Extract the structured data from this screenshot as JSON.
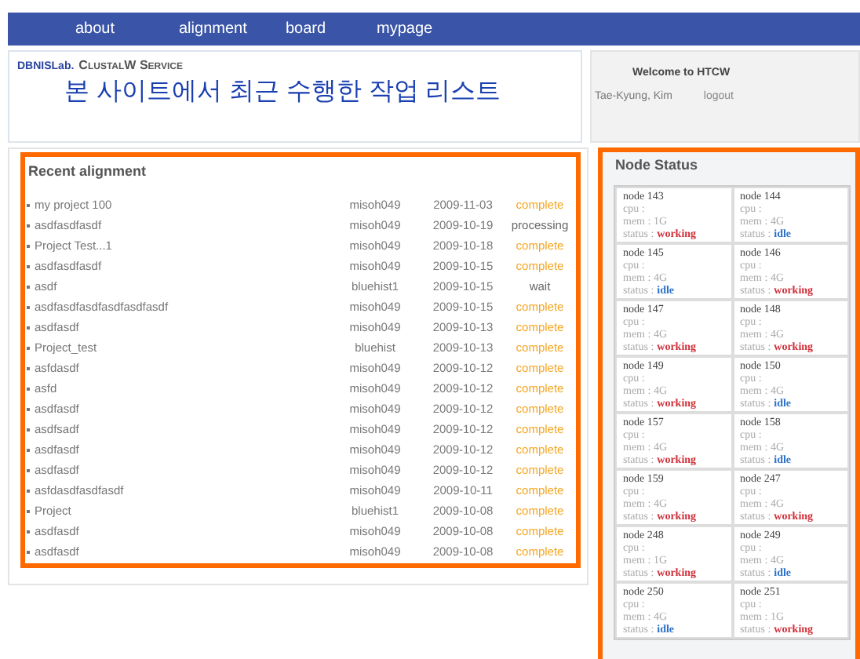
{
  "nav": [
    "about",
    "alignment",
    "board",
    "mypage"
  ],
  "header": {
    "brand": "DBNISLab.",
    "service": "ClustalW Service",
    "title": "본 사이트에서 최근 수행한 작업 리스트"
  },
  "welcome": {
    "title": "Welcome to HTCW",
    "user": "Tae-Kyung, Kim",
    "logout": "logout"
  },
  "recent": {
    "title": "Recent alignment",
    "rows": [
      {
        "name": "my project 100",
        "user": "misoh049",
        "date": "2009-11-03",
        "status": "complete",
        "kind": "complete"
      },
      {
        "name": "asdfasdfasdf",
        "user": "misoh049",
        "date": "2009-10-19",
        "status": "processing",
        "kind": "pending"
      },
      {
        "name": "Project Test...1",
        "user": "misoh049",
        "date": "2009-10-18",
        "status": "complete",
        "kind": "complete"
      },
      {
        "name": "asdfasdfasdf",
        "user": "misoh049",
        "date": "2009-10-15",
        "status": "complete",
        "kind": "complete"
      },
      {
        "name": "asdf",
        "user": "bluehist1",
        "date": "2009-10-15",
        "status": "wait",
        "kind": "pending"
      },
      {
        "name": "asdfasdfasdfasdfasdfasdf",
        "user": "misoh049",
        "date": "2009-10-15",
        "status": "complete",
        "kind": "complete"
      },
      {
        "name": "asdfasdf",
        "user": "misoh049",
        "date": "2009-10-13",
        "status": "complete",
        "kind": "complete"
      },
      {
        "name": "Project_test",
        "user": "bluehist",
        "date": "2009-10-13",
        "status": "complete",
        "kind": "complete"
      },
      {
        "name": "asfdasdf",
        "user": "misoh049",
        "date": "2009-10-12",
        "status": "complete",
        "kind": "complete"
      },
      {
        "name": "asfd",
        "user": "misoh049",
        "date": "2009-10-12",
        "status": "complete",
        "kind": "complete"
      },
      {
        "name": "asdfasdf",
        "user": "misoh049",
        "date": "2009-10-12",
        "status": "complete",
        "kind": "complete"
      },
      {
        "name": "asdfsadf",
        "user": "misoh049",
        "date": "2009-10-12",
        "status": "complete",
        "kind": "complete"
      },
      {
        "name": "asdfasdf",
        "user": "misoh049",
        "date": "2009-10-12",
        "status": "complete",
        "kind": "complete"
      },
      {
        "name": "asdfasdf",
        "user": "misoh049",
        "date": "2009-10-12",
        "status": "complete",
        "kind": "complete"
      },
      {
        "name": "asfdasdfasdfasdf",
        "user": "misoh049",
        "date": "2009-10-11",
        "status": "complete",
        "kind": "complete"
      },
      {
        "name": "Project",
        "user": "bluehist1",
        "date": "2009-10-08",
        "status": "complete",
        "kind": "complete"
      },
      {
        "name": "asdfasdf",
        "user": "misoh049",
        "date": "2009-10-08",
        "status": "complete",
        "kind": "complete"
      },
      {
        "name": "asdfasdf",
        "user": "misoh049",
        "date": "2009-10-08",
        "status": "complete",
        "kind": "complete"
      }
    ]
  },
  "nodes": {
    "title": "Node Status",
    "items": [
      {
        "name": "node 143",
        "cpu": "cpu :",
        "mem": "mem : 1G",
        "status_label": "status :",
        "status": "working",
        "kind": "working"
      },
      {
        "name": "node 144",
        "cpu": "cpu :",
        "mem": "mem : 4G",
        "status_label": "status :",
        "status": "idle",
        "kind": "idle"
      },
      {
        "name": "node 145",
        "cpu": "cpu :",
        "mem": "mem : 4G",
        "status_label": "status :",
        "status": "idle",
        "kind": "idle"
      },
      {
        "name": "node 146",
        "cpu": "cpu :",
        "mem": "mem : 4G",
        "status_label": "status :",
        "status": "working",
        "kind": "working"
      },
      {
        "name": "node 147",
        "cpu": "cpu :",
        "mem": "mem : 4G",
        "status_label": "status :",
        "status": "working",
        "kind": "working"
      },
      {
        "name": "node 148",
        "cpu": "cpu :",
        "mem": "mem : 4G",
        "status_label": "status :",
        "status": "working",
        "kind": "working"
      },
      {
        "name": "node 149",
        "cpu": "cpu :",
        "mem": "mem : 4G",
        "status_label": "status :",
        "status": "working",
        "kind": "working"
      },
      {
        "name": "node 150",
        "cpu": "cpu :",
        "mem": "mem : 4G",
        "status_label": "status :",
        "status": "idle",
        "kind": "idle"
      },
      {
        "name": "node 157",
        "cpu": "cpu :",
        "mem": "mem : 4G",
        "status_label": "status :",
        "status": "working",
        "kind": "working"
      },
      {
        "name": "node 158",
        "cpu": "cpu :",
        "mem": "mem : 4G",
        "status_label": "status :",
        "status": "idle",
        "kind": "idle"
      },
      {
        "name": "node 159",
        "cpu": "cpu :",
        "mem": "mem : 4G",
        "status_label": "status :",
        "status": "working",
        "kind": "working"
      },
      {
        "name": "node 247",
        "cpu": "cpu :",
        "mem": "mem : 4G",
        "status_label": "status :",
        "status": "working",
        "kind": "working"
      },
      {
        "name": "node 248",
        "cpu": "cpu :",
        "mem": "mem : 1G",
        "status_label": "status :",
        "status": "working",
        "kind": "working"
      },
      {
        "name": "node 249",
        "cpu": "cpu :",
        "mem": "mem : 4G",
        "status_label": "status :",
        "status": "idle",
        "kind": "idle"
      },
      {
        "name": "node 250",
        "cpu": "cpu :",
        "mem": "mem : 4G",
        "status_label": "status :",
        "status": "idle",
        "kind": "idle"
      },
      {
        "name": "node 251",
        "cpu": "cpu :",
        "mem": "mem : 1G",
        "status_label": "status :",
        "status": "working",
        "kind": "working"
      }
    ]
  }
}
